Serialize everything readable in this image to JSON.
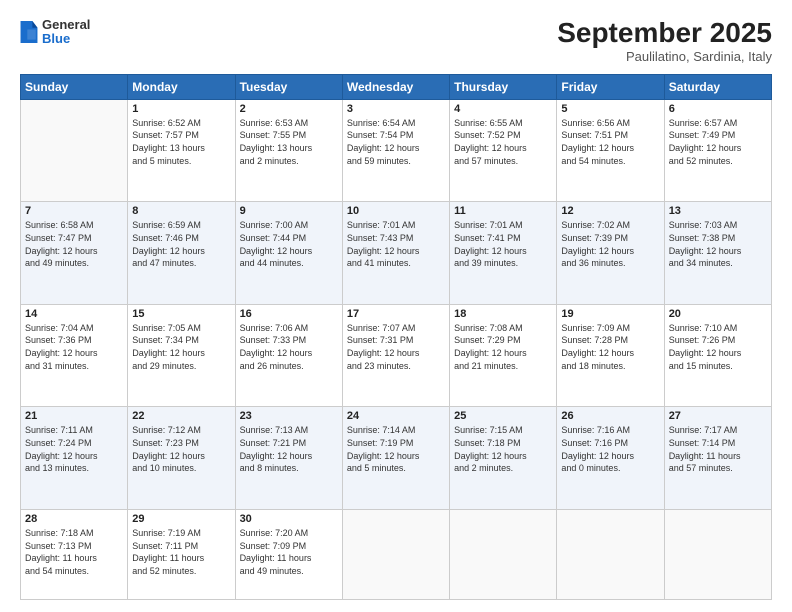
{
  "header": {
    "logo_line1": "General",
    "logo_line2": "Blue",
    "month_title": "September 2025",
    "subtitle": "Paulilatino, Sardinia, Italy"
  },
  "weekdays": [
    "Sunday",
    "Monday",
    "Tuesday",
    "Wednesday",
    "Thursday",
    "Friday",
    "Saturday"
  ],
  "weeks": [
    [
      {
        "day": "",
        "info": ""
      },
      {
        "day": "1",
        "info": "Sunrise: 6:52 AM\nSunset: 7:57 PM\nDaylight: 13 hours\nand 5 minutes."
      },
      {
        "day": "2",
        "info": "Sunrise: 6:53 AM\nSunset: 7:55 PM\nDaylight: 13 hours\nand 2 minutes."
      },
      {
        "day": "3",
        "info": "Sunrise: 6:54 AM\nSunset: 7:54 PM\nDaylight: 12 hours\nand 59 minutes."
      },
      {
        "day": "4",
        "info": "Sunrise: 6:55 AM\nSunset: 7:52 PM\nDaylight: 12 hours\nand 57 minutes."
      },
      {
        "day": "5",
        "info": "Sunrise: 6:56 AM\nSunset: 7:51 PM\nDaylight: 12 hours\nand 54 minutes."
      },
      {
        "day": "6",
        "info": "Sunrise: 6:57 AM\nSunset: 7:49 PM\nDaylight: 12 hours\nand 52 minutes."
      }
    ],
    [
      {
        "day": "7",
        "info": "Sunrise: 6:58 AM\nSunset: 7:47 PM\nDaylight: 12 hours\nand 49 minutes."
      },
      {
        "day": "8",
        "info": "Sunrise: 6:59 AM\nSunset: 7:46 PM\nDaylight: 12 hours\nand 47 minutes."
      },
      {
        "day": "9",
        "info": "Sunrise: 7:00 AM\nSunset: 7:44 PM\nDaylight: 12 hours\nand 44 minutes."
      },
      {
        "day": "10",
        "info": "Sunrise: 7:01 AM\nSunset: 7:43 PM\nDaylight: 12 hours\nand 41 minutes."
      },
      {
        "day": "11",
        "info": "Sunrise: 7:01 AM\nSunset: 7:41 PM\nDaylight: 12 hours\nand 39 minutes."
      },
      {
        "day": "12",
        "info": "Sunrise: 7:02 AM\nSunset: 7:39 PM\nDaylight: 12 hours\nand 36 minutes."
      },
      {
        "day": "13",
        "info": "Sunrise: 7:03 AM\nSunset: 7:38 PM\nDaylight: 12 hours\nand 34 minutes."
      }
    ],
    [
      {
        "day": "14",
        "info": "Sunrise: 7:04 AM\nSunset: 7:36 PM\nDaylight: 12 hours\nand 31 minutes."
      },
      {
        "day": "15",
        "info": "Sunrise: 7:05 AM\nSunset: 7:34 PM\nDaylight: 12 hours\nand 29 minutes."
      },
      {
        "day": "16",
        "info": "Sunrise: 7:06 AM\nSunset: 7:33 PM\nDaylight: 12 hours\nand 26 minutes."
      },
      {
        "day": "17",
        "info": "Sunrise: 7:07 AM\nSunset: 7:31 PM\nDaylight: 12 hours\nand 23 minutes."
      },
      {
        "day": "18",
        "info": "Sunrise: 7:08 AM\nSunset: 7:29 PM\nDaylight: 12 hours\nand 21 minutes."
      },
      {
        "day": "19",
        "info": "Sunrise: 7:09 AM\nSunset: 7:28 PM\nDaylight: 12 hours\nand 18 minutes."
      },
      {
        "day": "20",
        "info": "Sunrise: 7:10 AM\nSunset: 7:26 PM\nDaylight: 12 hours\nand 15 minutes."
      }
    ],
    [
      {
        "day": "21",
        "info": "Sunrise: 7:11 AM\nSunset: 7:24 PM\nDaylight: 12 hours\nand 13 minutes."
      },
      {
        "day": "22",
        "info": "Sunrise: 7:12 AM\nSunset: 7:23 PM\nDaylight: 12 hours\nand 10 minutes."
      },
      {
        "day": "23",
        "info": "Sunrise: 7:13 AM\nSunset: 7:21 PM\nDaylight: 12 hours\nand 8 minutes."
      },
      {
        "day": "24",
        "info": "Sunrise: 7:14 AM\nSunset: 7:19 PM\nDaylight: 12 hours\nand 5 minutes."
      },
      {
        "day": "25",
        "info": "Sunrise: 7:15 AM\nSunset: 7:18 PM\nDaylight: 12 hours\nand 2 minutes."
      },
      {
        "day": "26",
        "info": "Sunrise: 7:16 AM\nSunset: 7:16 PM\nDaylight: 12 hours\nand 0 minutes."
      },
      {
        "day": "27",
        "info": "Sunrise: 7:17 AM\nSunset: 7:14 PM\nDaylight: 11 hours\nand 57 minutes."
      }
    ],
    [
      {
        "day": "28",
        "info": "Sunrise: 7:18 AM\nSunset: 7:13 PM\nDaylight: 11 hours\nand 54 minutes."
      },
      {
        "day": "29",
        "info": "Sunrise: 7:19 AM\nSunset: 7:11 PM\nDaylight: 11 hours\nand 52 minutes."
      },
      {
        "day": "30",
        "info": "Sunrise: 7:20 AM\nSunset: 7:09 PM\nDaylight: 11 hours\nand 49 minutes."
      },
      {
        "day": "",
        "info": ""
      },
      {
        "day": "",
        "info": ""
      },
      {
        "day": "",
        "info": ""
      },
      {
        "day": "",
        "info": ""
      }
    ]
  ]
}
